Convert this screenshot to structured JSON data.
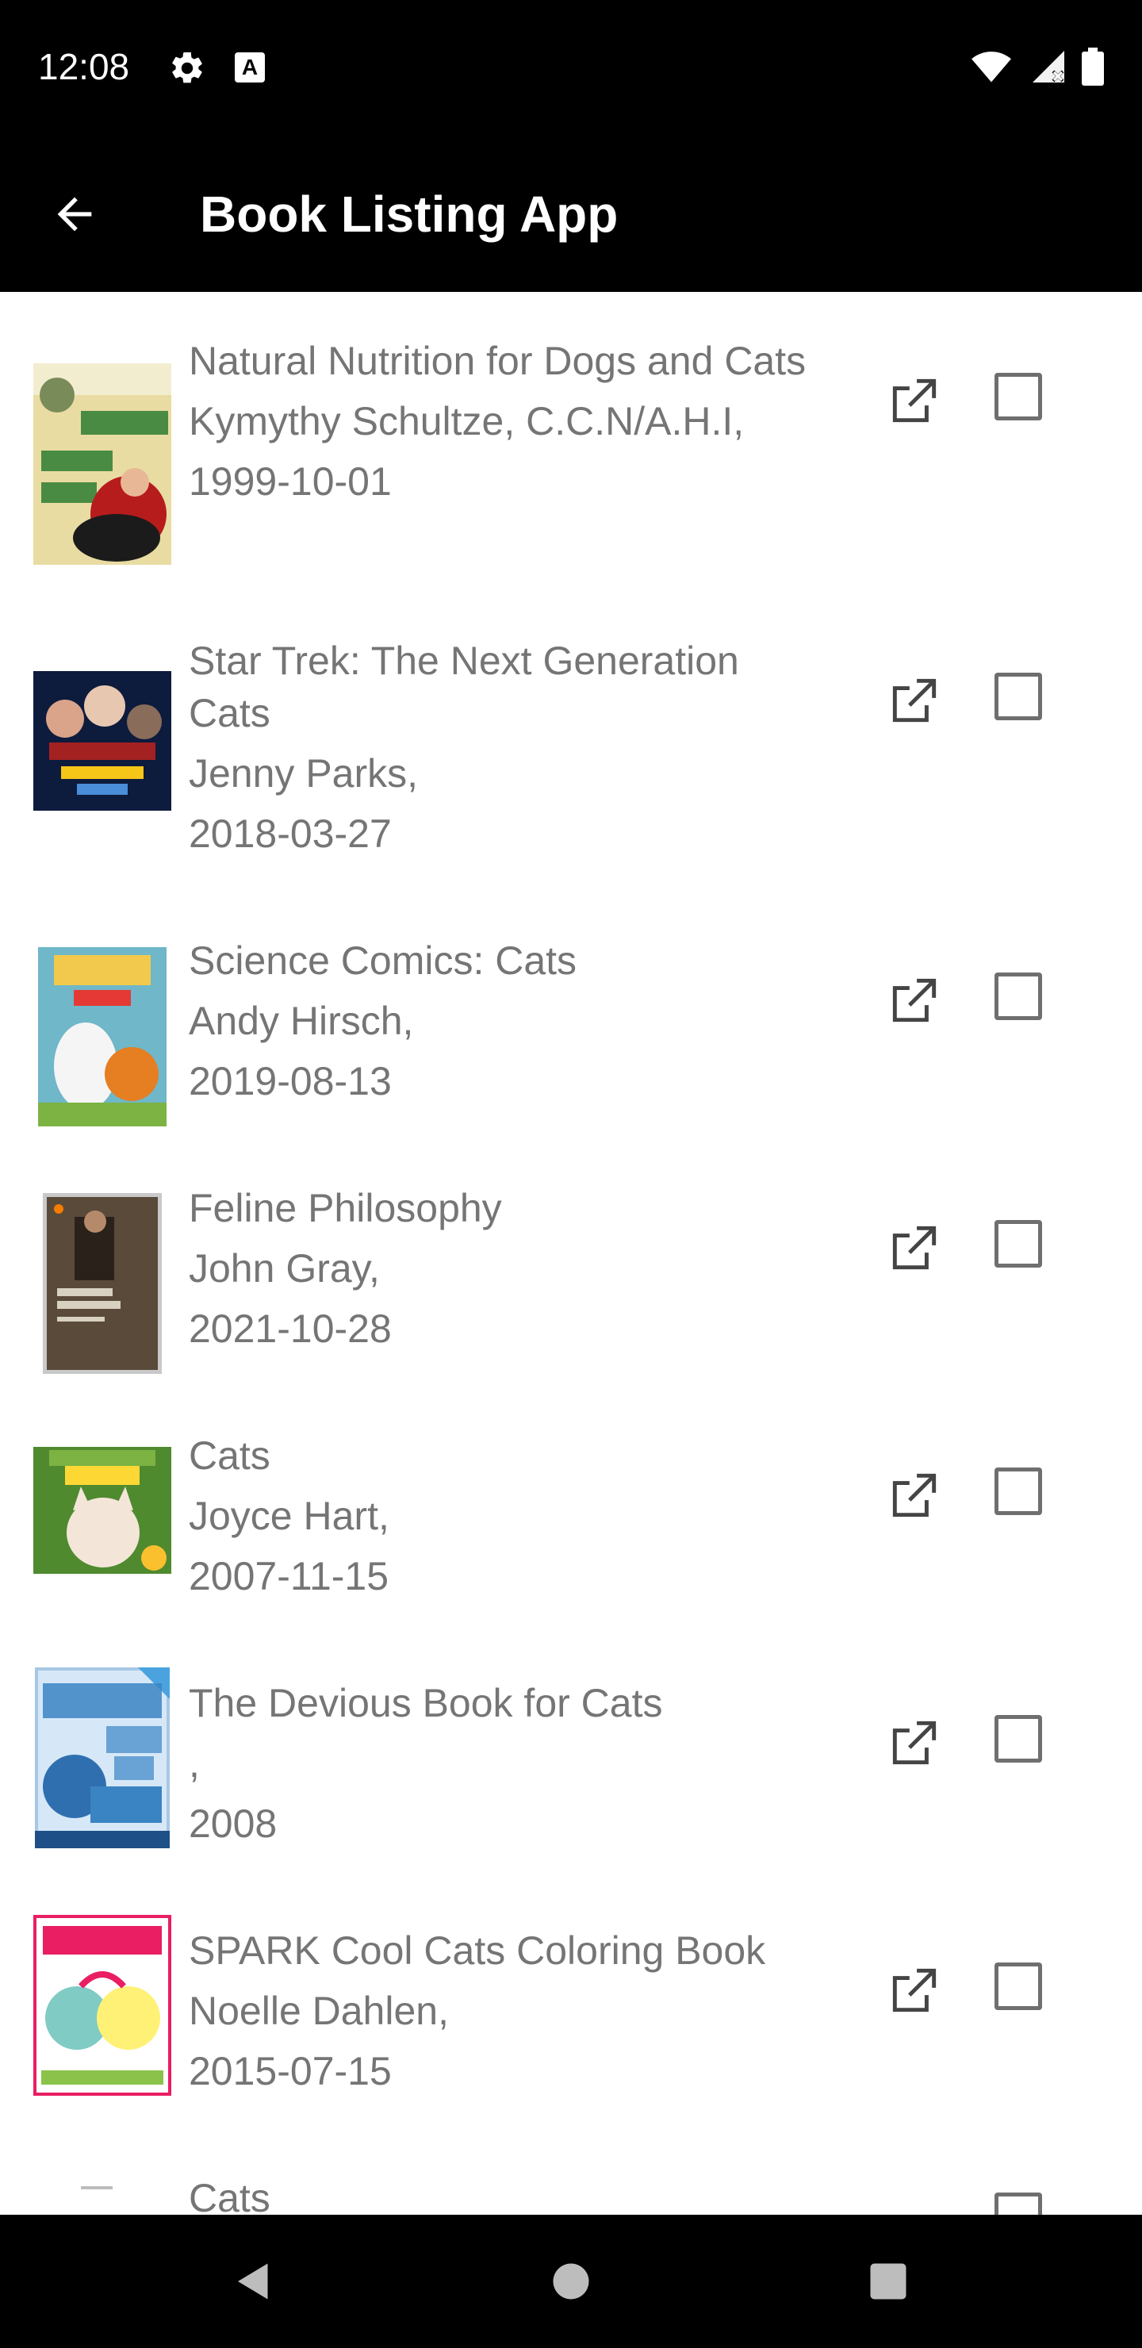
{
  "status_bar": {
    "time": "12:08",
    "icons": [
      "gear-icon",
      "a-notification-icon",
      "wifi-icon",
      "signal-icon",
      "battery-icon"
    ]
  },
  "app_bar": {
    "title": "Book Listing App",
    "back_icon": "back-arrow-icon"
  },
  "books": [
    {
      "title": "Natural Nutrition for Dogs and Cats",
      "author": "Kymythy Schultze, C.C.N/A.H.I,",
      "date": "1999-10-01",
      "cover_icon": "book-cover-image",
      "open_icon": "open-external-icon",
      "checked": false
    },
    {
      "title": "Star Trek: The Next Generation Cats",
      "author": "Jenny Parks,",
      "date": "2018-03-27",
      "cover_icon": "book-cover-image",
      "open_icon": "open-external-icon",
      "checked": false
    },
    {
      "title": "Science Comics: Cats",
      "author": "Andy Hirsch,",
      "date": "2019-08-13",
      "cover_icon": "book-cover-image",
      "open_icon": "open-external-icon",
      "checked": false
    },
    {
      "title": "Feline Philosophy",
      "author": "John Gray,",
      "date": "2021-10-28",
      "cover_icon": "book-cover-image",
      "open_icon": "open-external-icon",
      "checked": false
    },
    {
      "title": "Cats",
      "author": "Joyce Hart,",
      "date": "2007-11-15",
      "cover_icon": "book-cover-image",
      "open_icon": "open-external-icon",
      "checked": false
    },
    {
      "title": "The Devious Book for Cats",
      "author": ",",
      "date": "2008",
      "cover_icon": "book-cover-image",
      "open_icon": "open-external-icon",
      "checked": false
    },
    {
      "title": "SPARK Cool Cats Coloring Book",
      "author": "Noelle Dahlen,",
      "date": "2015-07-15",
      "cover_icon": "book-cover-image",
      "open_icon": "open-external-icon",
      "checked": false
    },
    {
      "title": "Cats",
      "author": "",
      "date": "",
      "cover_icon": "book-cover-image",
      "open_icon": "open-external-icon",
      "checked": false
    }
  ],
  "nav_bar": {
    "back": "nav-back-icon",
    "home": "nav-home-icon",
    "recents": "nav-recents-icon"
  },
  "colors": {
    "bars": "#000000",
    "list_text": "#757575",
    "checkbox_border": "#6f6f6f",
    "background": "#ffffff"
  }
}
